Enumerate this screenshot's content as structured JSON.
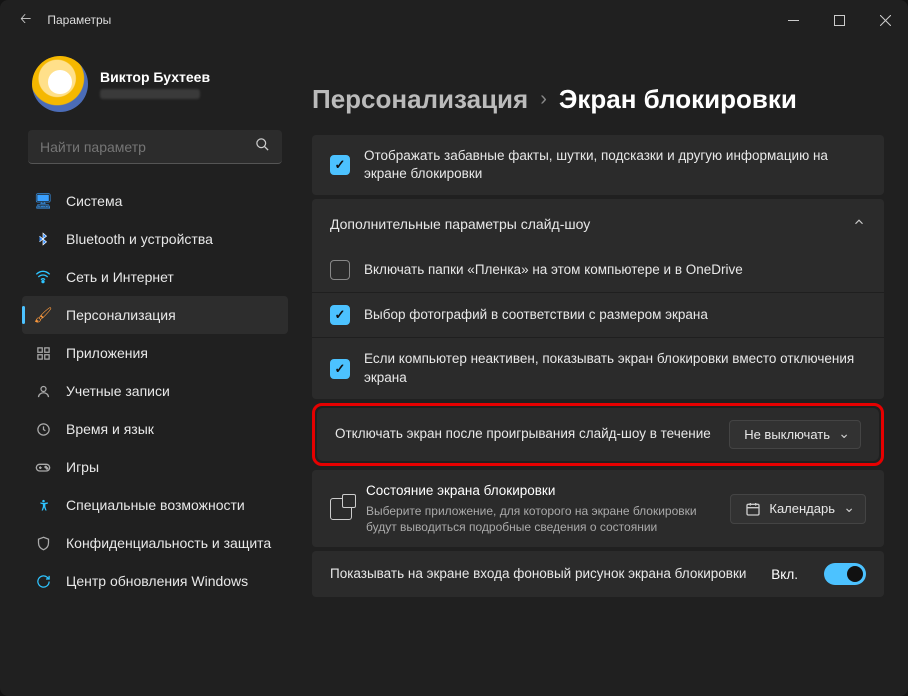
{
  "titlebar": {
    "title": "Параметры"
  },
  "user": {
    "name": "Виктор Бухтеев"
  },
  "search": {
    "placeholder": "Найти параметр"
  },
  "nav": {
    "items": [
      "Система",
      "Bluetooth и устройства",
      "Сеть и Интернет",
      "Персонализация",
      "Приложения",
      "Учетные записи",
      "Время и язык",
      "Игры",
      "Специальные возможности",
      "Конфиденциальность и защита",
      "Центр обновления Windows"
    ]
  },
  "breadcrumb": {
    "section": "Персонализация",
    "page": "Экран блокировки"
  },
  "setting_fun": "Отображать забавные факты, шутки, подсказки и другую информацию на экране блокировки",
  "expander_title": "Дополнительные параметры слайд-шоу",
  "opt_film": "Включать папки «Пленка» на этом компьютере и в OneDrive",
  "opt_fit": "Выбор фотографий в соответствии с размером экрана",
  "opt_inactive": "Если компьютер неактивен, показывать экран блокировки вместо отключения экрана",
  "opt_turnoff": "Отключать экран после проигрывания слайд-шоу в течение",
  "opt_turnoff_value": "Не выключать",
  "status": {
    "title": "Состояние экрана блокировки",
    "desc": "Выберите приложение, для которого на экране блокировки будут выводиться подробные сведения о состоянии",
    "value": "Календарь"
  },
  "show_bg": "Показывать на экране входа фоновый рисунок экрана блокировки",
  "toggle_on": "Вкл."
}
